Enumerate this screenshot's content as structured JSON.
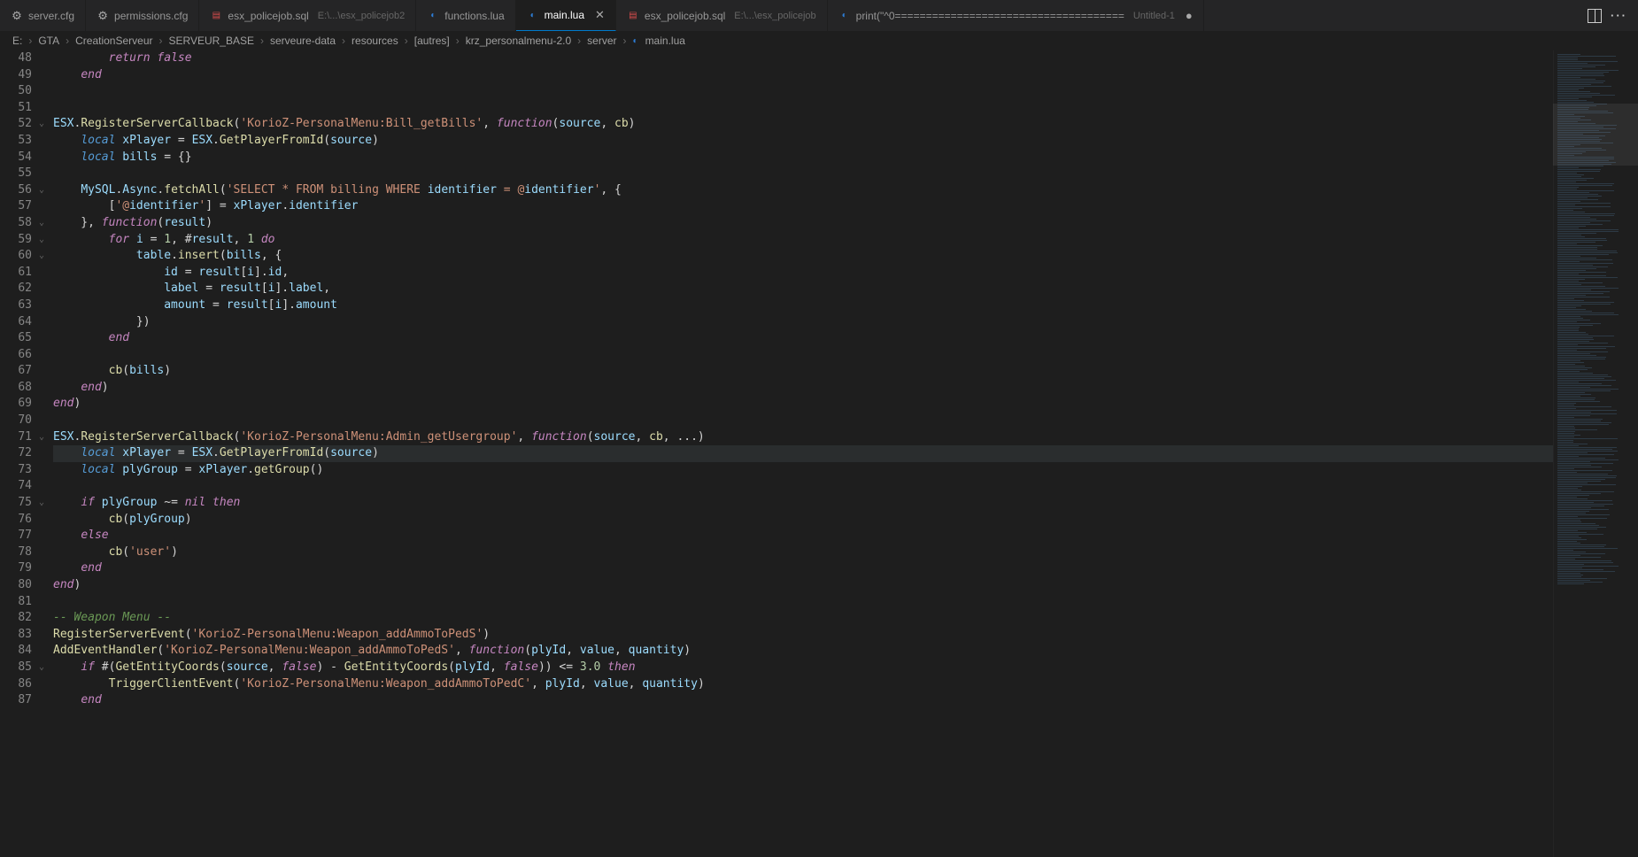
{
  "tabs": [
    {
      "icon": "gear",
      "label": "server.cfg"
    },
    {
      "icon": "gear",
      "label": "permissions.cfg"
    },
    {
      "icon": "sql",
      "label": "esx_policejob.sql",
      "dim": "E:\\...\\esx_policejob2"
    },
    {
      "icon": "lua",
      "label": "functions.lua"
    },
    {
      "icon": "lua",
      "label": "main.lua",
      "active": true,
      "close": true
    },
    {
      "icon": "sql",
      "label": "esx_policejob.sql",
      "dim": "E:\\...\\esx_policejob"
    },
    {
      "icon": "lua",
      "label": "print(\"^0=====================================",
      "dim": "Untitled-1",
      "modified": true
    }
  ],
  "breadcrumbs": [
    "E:",
    "GTA",
    "CreationServeur",
    "SERVEUR_BASE",
    "serveure-data",
    "resources",
    "[autres]",
    "krz_personalmenu-2.0",
    "server",
    "main.lua"
  ],
  "startLine": 48,
  "foldLines": [
    52,
    56,
    58,
    59,
    60,
    71,
    75,
    85
  ],
  "activeLine": 72,
  "code": [
    "        return false",
    "    end",
    "",
    "",
    "ESX.RegisterServerCallback('KorioZ-PersonalMenu:Bill_getBills', function(source, cb)",
    "    local xPlayer = ESX.GetPlayerFromId(source)",
    "    local bills = {}",
    "",
    "    MySQL.Async.fetchAll('SELECT * FROM billing WHERE identifier = @identifier', {",
    "        ['@identifier'] = xPlayer.identifier",
    "    }, function(result)",
    "        for i = 1, #result, 1 do",
    "            table.insert(bills, {",
    "                id = result[i].id,",
    "                label = result[i].label,",
    "                amount = result[i].amount",
    "            })",
    "        end",
    "",
    "        cb(bills)",
    "    end)",
    "end)",
    "",
    "ESX.RegisterServerCallback('KorioZ-PersonalMenu:Admin_getUsergroup', function(source, cb, ...)",
    "    local xPlayer = ESX.GetPlayerFromId(source)",
    "    local plyGroup = xPlayer.getGroup()",
    "",
    "    if plyGroup ~= nil then",
    "        cb(plyGroup)",
    "    else",
    "        cb('user')",
    "    end",
    "end)",
    "",
    "-- Weapon Menu --",
    "RegisterServerEvent('KorioZ-PersonalMenu:Weapon_addAmmoToPedS')",
    "AddEventHandler('KorioZ-PersonalMenu:Weapon_addAmmoToPedS', function(plyId, value, quantity)",
    "    if #(GetEntityCoords(source, false) - GetEntityCoords(plyId, false)) <= 3.0 then",
    "        TriggerClientEvent('KorioZ-PersonalMenu:Weapon_addAmmoToPedC', plyId, value, quantity)",
    "    end"
  ]
}
